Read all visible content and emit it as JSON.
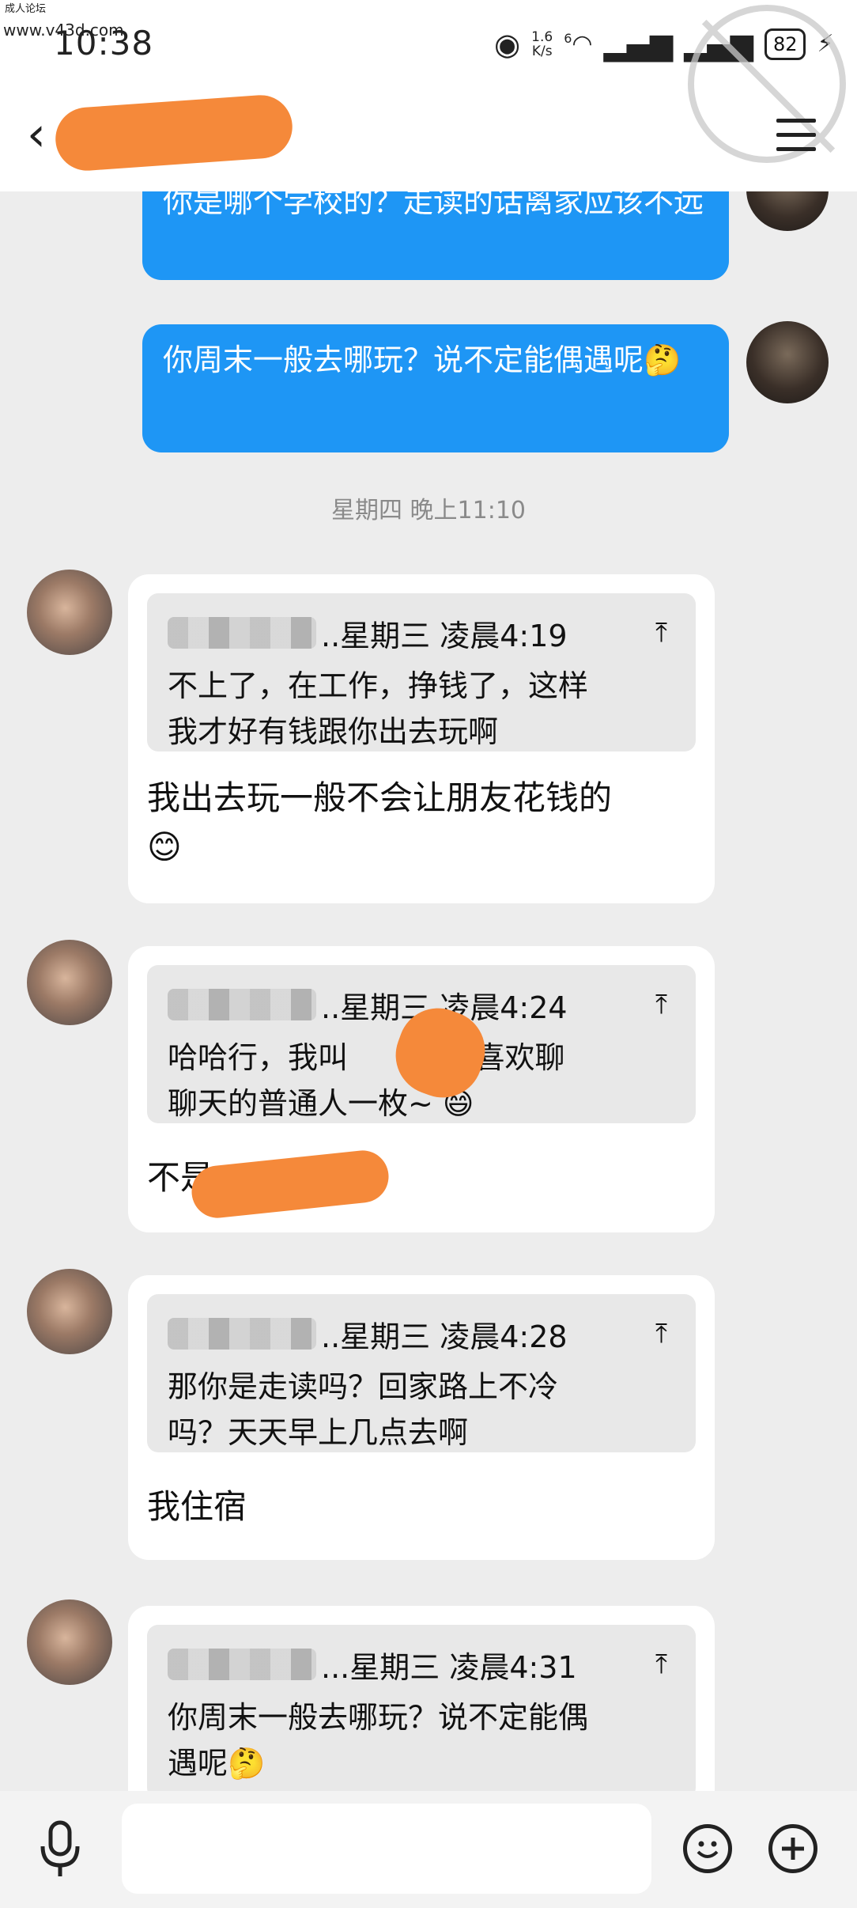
{
  "watermark": {
    "site_name": "成人论坛",
    "site_url": "www.v43d.com"
  },
  "status_bar": {
    "time": "10:38",
    "net_speed_value": "1.6",
    "net_speed_unit": "K/s",
    "network_type": "6",
    "battery": "82",
    "icons": [
      "eye-icon",
      "wifi-icon",
      "signal-icon",
      "signal-icon",
      "charging-icon"
    ]
  },
  "header": {
    "back_icon": "chevron-left-icon",
    "menu_icon": "hamburger-icon"
  },
  "sent_messages": [
    {
      "text": "你是哪个学校的？走读的话离家应该不远"
    },
    {
      "text": "你周末一般去哪玩？说不定能偶遇呢🤔"
    }
  ],
  "time_separator": "星期四 晚上11:10",
  "received_messages": [
    {
      "quote_time": "..星期三 凌晨4:19",
      "quote_text": "不上了，在工作，挣钱了，这样\n我才好有钱跟你出去玩啊",
      "text": "我出去玩一般不会让朋友花钱的\n😊"
    },
    {
      "quote_time": "..星期三 凌晨4:24",
      "quote_text": "哈哈行，我叫       平时喜欢聊\n聊天的普通人一枚~ 😄",
      "text": "不是"
    },
    {
      "quote_time": "..星期三 凌晨4:28",
      "quote_text": "那你是走读吗？回家路上不冷\n吗？天天早上几点去啊",
      "text": "我住宿"
    },
    {
      "quote_time": "...星期三 凌晨4:31",
      "quote_text": "你周末一般去哪玩？说不定能偶\n遇呢🤔",
      "text": ""
    }
  ],
  "input_bar": {
    "placeholder": "",
    "left_icon": "microphone-icon",
    "emoji_icon": "smiley-icon",
    "plus_icon": "plus-icon"
  }
}
